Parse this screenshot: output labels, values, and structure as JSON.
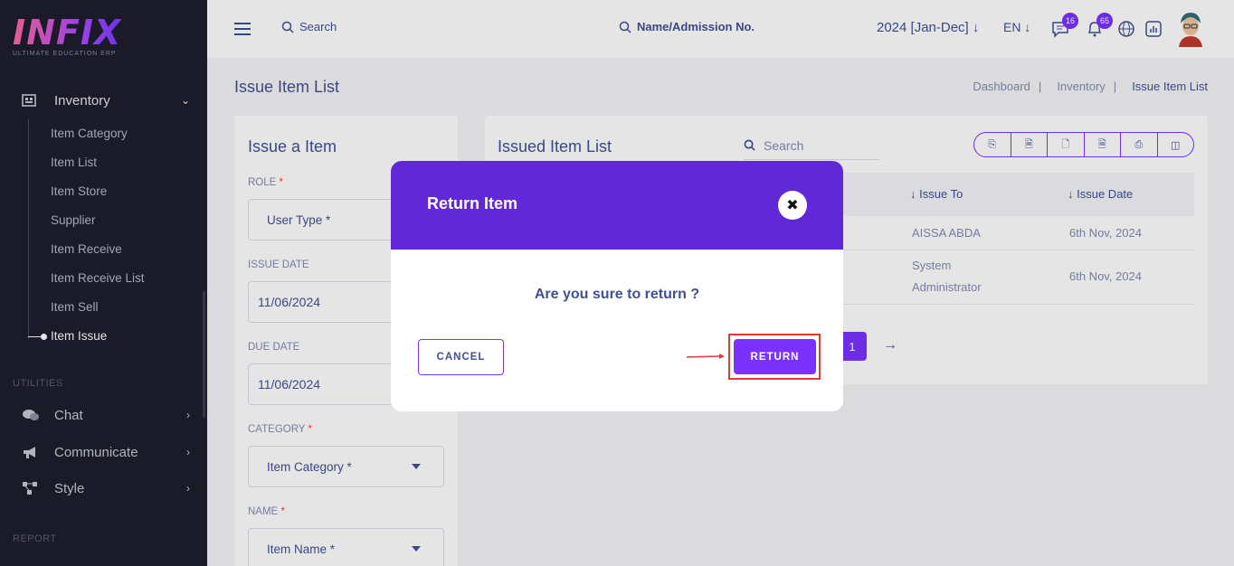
{
  "brand": {
    "logo_text": "INFIX",
    "tagline": "ULTIMATE EDUCATION ERP"
  },
  "sidebar": {
    "inventory_label": "Inventory",
    "inventory_items": [
      "Item Category",
      "Item List",
      "Item Store",
      "Supplier",
      "Item Receive",
      "Item Receive List",
      "Item Sell",
      "Item Issue"
    ],
    "active_item": "Item Issue",
    "utilities_label": "UTILITIES",
    "utilities_items": [
      {
        "label": "Chat",
        "icon": "chat-icon"
      },
      {
        "label": "Communicate",
        "icon": "megaphone-icon"
      },
      {
        "label": "Style",
        "icon": "style-icon"
      }
    ],
    "report_label": "REPORT"
  },
  "topbar": {
    "search_label": "Search",
    "admission_search_label": "Name/Admission No.",
    "year": "2024 [Jan-Dec]",
    "lang": "EN",
    "message_count": "16",
    "notification_count": "65"
  },
  "page": {
    "title": "Issue Item List",
    "breadcrumbs": [
      "Dashboard",
      "Inventory",
      "Issue Item List"
    ]
  },
  "form": {
    "title": "Issue a Item",
    "role_label": "ROLE",
    "role_placeholder": "User Type *",
    "issue_date_label": "ISSUE DATE",
    "issue_date_value": "11/06/2024",
    "due_date_label": "DUE DATE",
    "due_date_value": "11/06/2024",
    "category_label": "CATEGORY",
    "category_placeholder": "Item Category *",
    "name_label": "NAME",
    "name_placeholder": "Item Name *"
  },
  "table": {
    "title": "Issued Item List",
    "search_placeholder": "Search",
    "columns": [
      "Issue To",
      "Issue Date"
    ],
    "rows": [
      {
        "issue_to": "AISSA ABDA",
        "issue_date": "6th Nov, 2024"
      },
      {
        "issue_to_line1": "System",
        "issue_to_line2": "Administrator",
        "issue_date": "6th Nov, 2024"
      }
    ],
    "current_page": "1"
  },
  "modal": {
    "title": "Return Item",
    "question": "Are you sure to return ?",
    "cancel_label": "CANCEL",
    "return_label": "RETURN"
  },
  "colors": {
    "accent": "#7c32ff",
    "modal_header": "#6128d8",
    "highlight": "#e53935",
    "sidebar_bg": "#1e1d2e"
  }
}
